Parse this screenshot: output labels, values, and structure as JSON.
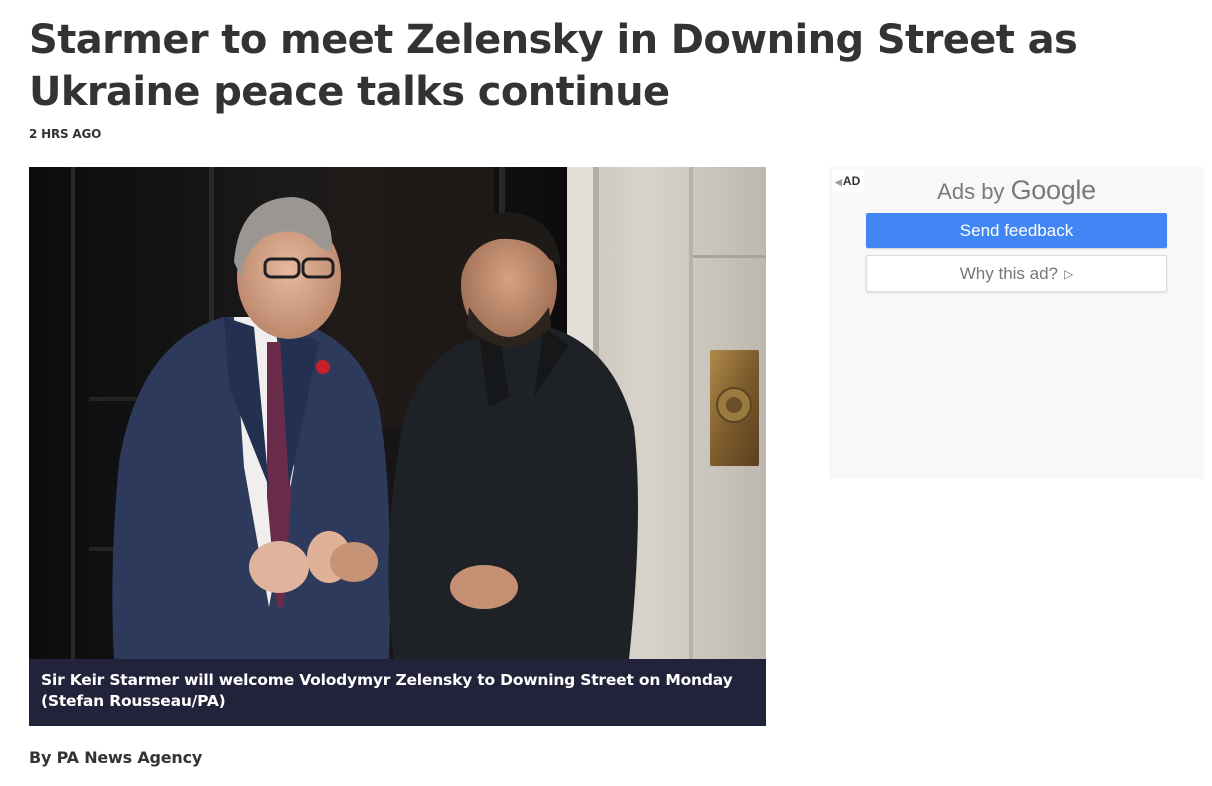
{
  "article": {
    "headline": "Starmer to meet Zelensky in Downing Street as Ukraine peace talks continue",
    "timestamp": "2 HRS AGO",
    "caption": "Sir Keir Starmer will welcome Volodymyr Zelensky to Downing Street on Monday (Stefan Rousseau/PA)",
    "byline": "By PA News Agency"
  },
  "ad": {
    "badge": "AD",
    "ads_by_prefix": "Ads by",
    "ads_by_brand": "Google",
    "send_feedback_label": "Send feedback",
    "why_this_ad_label": "Why this ad?",
    "button_color": "#4285f4"
  },
  "icons": {
    "adchoices": "adchoices-icon",
    "play": "play-triangle-icon"
  }
}
